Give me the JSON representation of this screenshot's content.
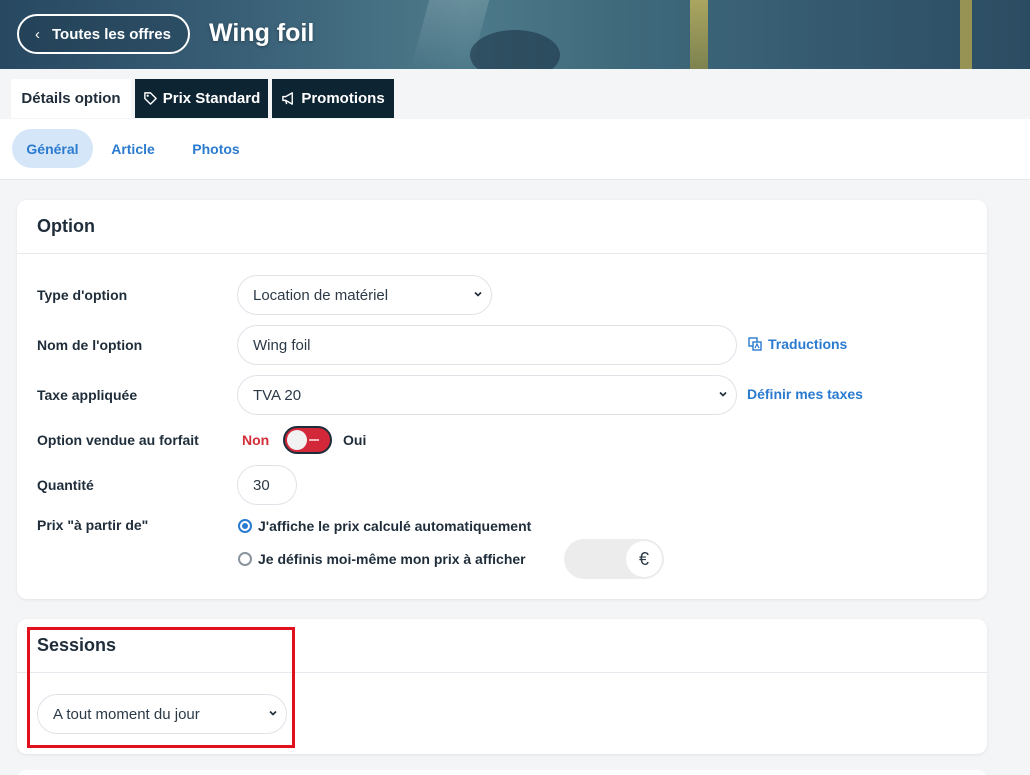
{
  "header": {
    "back_label": "Toutes les offres",
    "title": "Wing foil"
  },
  "main_tabs": [
    {
      "label": "Détails option",
      "icon": "none",
      "active": true
    },
    {
      "label": "Prix Standard",
      "icon": "tag-icon"
    },
    {
      "label": "Promotions",
      "icon": "megaphone-icon"
    }
  ],
  "sub_tabs": [
    {
      "label": "Général",
      "active": true
    },
    {
      "label": "Article"
    },
    {
      "label": "Photos"
    }
  ],
  "option_card": {
    "title": "Option",
    "type_label": "Type d'option",
    "type_value": "Location de matériel",
    "name_label": "Nom de l'option",
    "name_value": "Wing foil",
    "translations_link": "Traductions",
    "tax_label": "Taxe appliquée",
    "tax_value": "TVA 20",
    "tax_link": "Définir mes taxes",
    "flat_label": "Option vendue au forfait",
    "flat_no": "Non",
    "flat_yes": "Oui",
    "quantity_label": "Quantité",
    "quantity_value": "30",
    "price_label": "Prix \"à partir de\"",
    "price_auto": "J'affiche le prix calculé automatiquement",
    "price_manual": "Je définis moi-même mon prix à afficher",
    "currency": "€"
  },
  "sessions_card": {
    "title": "Sessions",
    "value": "A tout moment du jour"
  },
  "colors": {
    "accent": "#2a7bd0",
    "dark_tab": "#0d2433",
    "danger": "#d3283a",
    "highlight": "#e0101d"
  }
}
